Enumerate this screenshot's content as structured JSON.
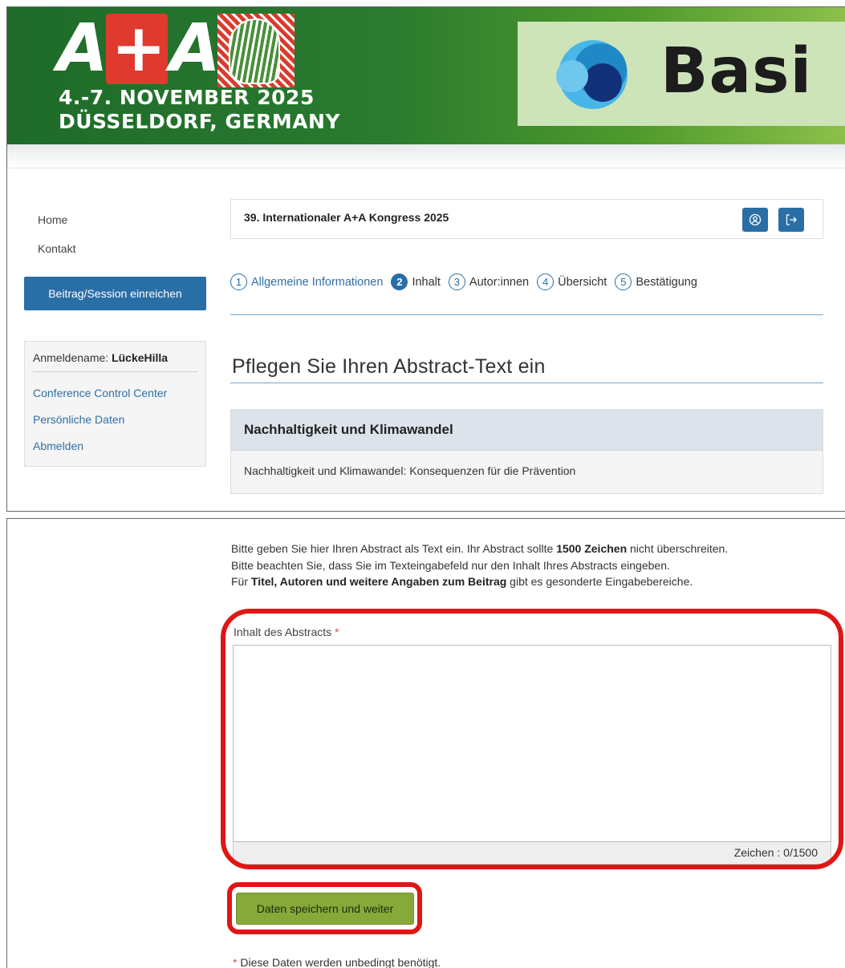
{
  "header": {
    "event_logo": "A+A",
    "event_date_line1": "4.-7. NOVEMBER 2025",
    "event_date_line2": "DÜSSELDORF, GERMANY",
    "sponsor_name": "Basi"
  },
  "nav": {
    "home": "Home",
    "contact": "Kontakt",
    "submit_button": "Beitrag/Session einreichen"
  },
  "user_box": {
    "login_label": "Anmeldename:",
    "login_name": "LückeHilla",
    "links": [
      "Conference Control Center",
      "Persönliche Daten",
      "Abmelden"
    ]
  },
  "congress": {
    "title": "39. Internationaler A+A Kongress 2025",
    "icons": [
      "user-profile-icon",
      "logout-icon"
    ]
  },
  "steps": [
    {
      "num": "1",
      "label": "Allgemeine Informationen",
      "state": "done"
    },
    {
      "num": "2",
      "label": "Inhalt",
      "state": "active"
    },
    {
      "num": "3",
      "label": "Autor:innen",
      "state": "todo"
    },
    {
      "num": "4",
      "label": "Übersicht",
      "state": "todo"
    },
    {
      "num": "5",
      "label": "Bestätigung",
      "state": "todo"
    }
  ],
  "page_heading": "Pflegen Sie Ihren Abstract-Text ein",
  "topic": {
    "title": "Nachhaltigkeit und Klimawandel",
    "subtitle": "Nachhaltigkeit und Klimawandel: Konsequenzen für die Prävention"
  },
  "info": {
    "line1_a": "Bitte geben Sie hier Ihren Abstract als Text ein. Ihr Abstract sollte ",
    "line1_b": "1500 Zeichen",
    "line1_c": " nicht überschreiten.",
    "line2": "Bitte beachten Sie, dass Sie im Texteingabefeld nur den Inhalt Ihres Abstracts eingeben.",
    "line3_a": "Für ",
    "line3_b": "Titel, Autoren und weitere Angaben zum Beitrag",
    "line3_c": " gibt es gesonderte Eingabebereiche."
  },
  "abstract_field": {
    "label": "Inhalt des Abstracts",
    "required_mark": "*",
    "value": "",
    "counter": "Zeichen : 0/1500"
  },
  "save_button": "Daten speichern und weiter",
  "required_note": {
    "mark": "*",
    "text": " Diese Daten werden unbedingt benötigt."
  },
  "colors": {
    "primary": "#2a6ea6",
    "save_button": "#86a93a",
    "highlight": "#e01616",
    "banner_green": "#1f6b2a"
  }
}
